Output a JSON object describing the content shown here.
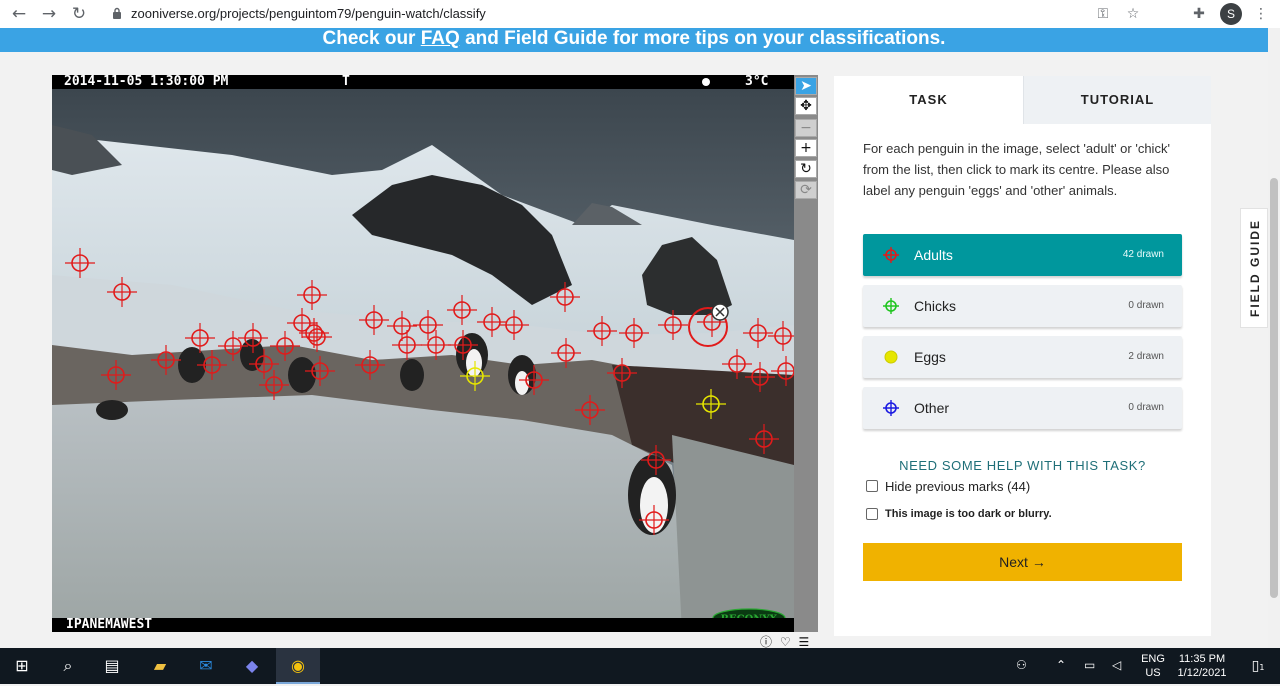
{
  "browser": {
    "url": "zooniverse.org/projects/penguintom79/penguin-watch/classify",
    "profile_initial": "S"
  },
  "banner": {
    "before": "Check our ",
    "faq": "FAQ",
    "after": " and Field Guide for more tips on your classifications."
  },
  "subject": {
    "timestamp": "2014-11-05 1:30:00 PM",
    "camera_flag": "T",
    "temperature": "3°C",
    "site": "IPANEMAWEST",
    "brand": "RECONYX"
  },
  "task_panel": {
    "tabs": [
      "TASK",
      "TUTORIAL"
    ],
    "instruction": "For each penguin in the image, select 'adult' or 'chick' from the list, then click to mark its centre. Please also label any penguin 'eggs' and 'other' animals.",
    "tools": [
      {
        "label": "Adults",
        "count": "42 drawn",
        "color": "#e11b1b"
      },
      {
        "label": "Chicks",
        "count": "0 drawn",
        "color": "#20c520"
      },
      {
        "label": "Eggs",
        "count": "2 drawn",
        "color": "#e6e600"
      },
      {
        "label": "Other",
        "count": "0 drawn",
        "color": "#1b1be1"
      }
    ],
    "help": "NEED SOME HELP WITH THIS TASK?",
    "hide_marks": "Hide previous marks (44)",
    "too_dark": "This image is too dark or blurry.",
    "next": "Next →"
  },
  "field_guide": "FIELD GUIDE",
  "taskbar": {
    "lang_top": "ENG",
    "lang_bottom": "US",
    "time": "11:35 PM",
    "date": "1/12/2021",
    "notification_count": "1"
  }
}
